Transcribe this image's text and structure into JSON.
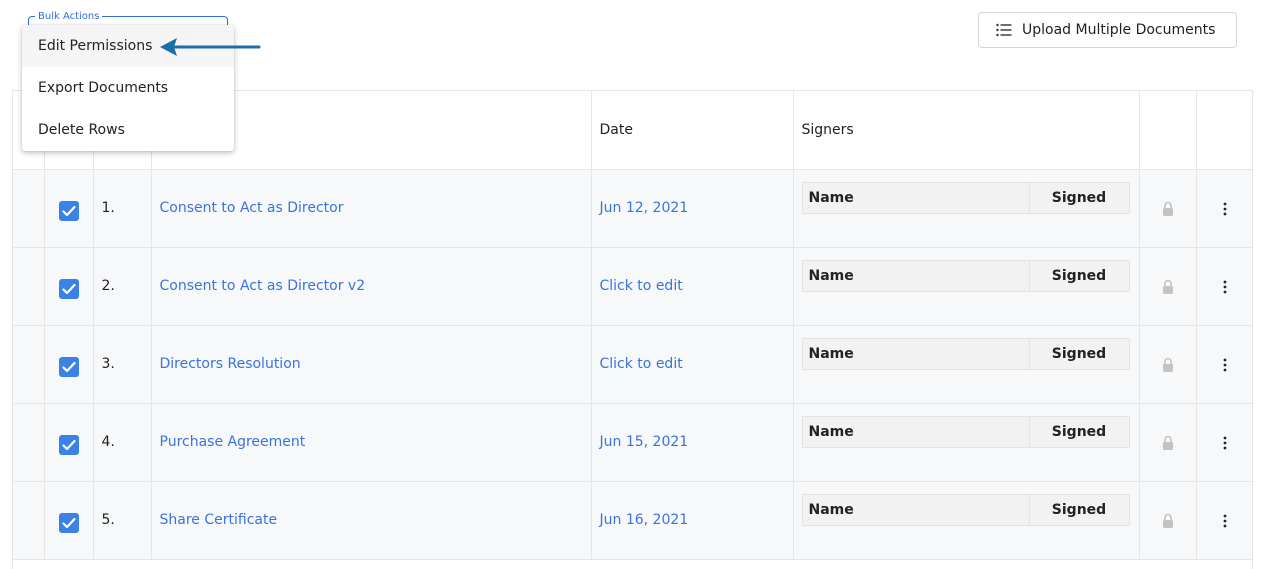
{
  "upload_button": {
    "label": "Upload Multiple Documents",
    "icon": "list-icon"
  },
  "bulk_actions": {
    "label": "Bulk Actions",
    "items": [
      {
        "label": "Edit Permissions",
        "highlighted": true
      },
      {
        "label": "Export Documents",
        "highlighted": false
      },
      {
        "label": "Delete Rows",
        "highlighted": false
      }
    ]
  },
  "table": {
    "headers": {
      "date": "Date",
      "signers": "Signers"
    },
    "rows": [
      {
        "number": "1.",
        "document": "Consent to Act as Director",
        "date": "Jun 12, 2021",
        "checked": true,
        "signer_name": "Name",
        "signer_status": "Signed"
      },
      {
        "number": "2.",
        "document": "Consent to Act as Director v2",
        "date": "Click to edit",
        "checked": true,
        "signer_name": "Name",
        "signer_status": "Signed"
      },
      {
        "number": "3.",
        "document": "Directors Resolution",
        "date": "Click to edit",
        "checked": true,
        "signer_name": "Name",
        "signer_status": "Signed"
      },
      {
        "number": "4.",
        "document": "Purchase Agreement",
        "date": "Jun 15, 2021",
        "checked": true,
        "signer_name": "Name",
        "signer_status": "Signed"
      },
      {
        "number": "5.",
        "document": "Share Certificate",
        "date": "Jun 16, 2021",
        "checked": true,
        "signer_name": "Name",
        "signer_status": "Signed"
      }
    ]
  },
  "colors": {
    "accent": "#3b82e6",
    "link": "#3b73d9",
    "bulk_label": "#2f6fd6",
    "arrow": "#1a6fa8"
  }
}
